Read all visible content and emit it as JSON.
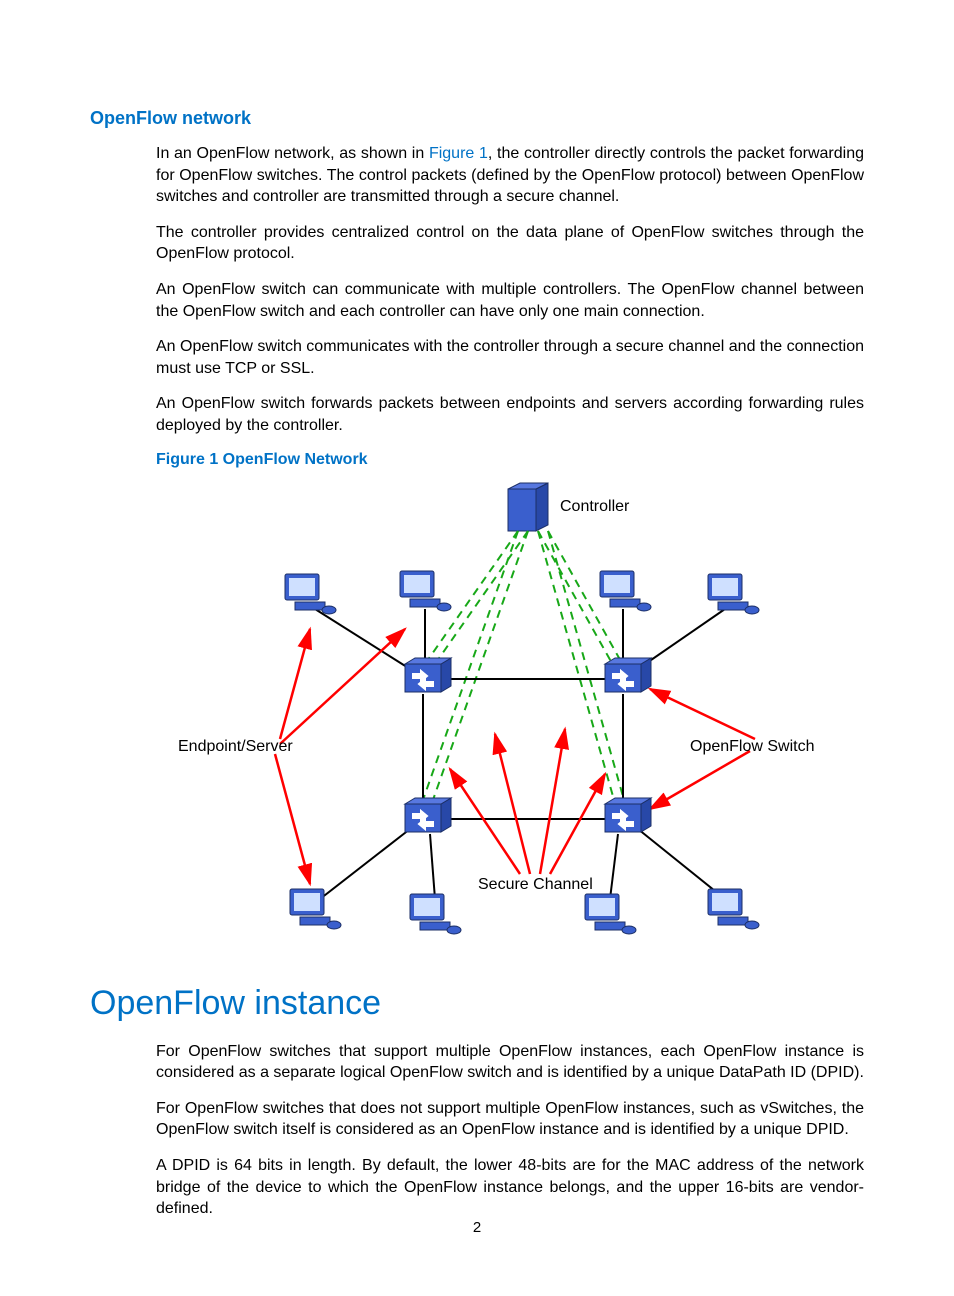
{
  "section1": {
    "heading": "OpenFlow network",
    "p1_a": "In an OpenFlow network, as shown in ",
    "p1_link": "Figure 1",
    "p1_b": ", the controller directly controls the packet forwarding for OpenFlow switches. The control packets (defined by the OpenFlow protocol) between OpenFlow switches and controller are transmitted through a secure channel.",
    "p2": "The controller provides centralized control on the data plane of OpenFlow switches through the OpenFlow protocol.",
    "p3": "An OpenFlow switch can communicate with multiple controllers. The OpenFlow channel between the OpenFlow switch and each controller can have only one main connection.",
    "p4": "An OpenFlow switch communicates with the controller through a secure channel and the connection must use TCP or SSL.",
    "p5": "An OpenFlow switch forwards packets between endpoints and servers according forwarding rules deployed by the controller."
  },
  "figure": {
    "caption": "Figure 1 OpenFlow Network",
    "labels": {
      "controller": "Controller",
      "endpoint": "Endpoint/Server",
      "switch": "OpenFlow Switch",
      "secure": "Secure Channel"
    }
  },
  "section2": {
    "heading": "OpenFlow instance",
    "p1": "For OpenFlow switches that support multiple OpenFlow instances, each OpenFlow instance is considered as a separate logical OpenFlow switch and is identified by a unique DataPath ID (DPID).",
    "p2": "For OpenFlow switches that does not support multiple OpenFlow instances, such as vSwitches, the OpenFlow switch itself is considered as an OpenFlow instance and is identified by a unique DPID.",
    "p3": "A DPID is 64 bits in length. By default, the lower 48-bits are for the MAC address of the network bridge of the device to which the OpenFlow instance belongs, and the upper 16-bits are vendor-defined."
  },
  "pageNumber": "2"
}
